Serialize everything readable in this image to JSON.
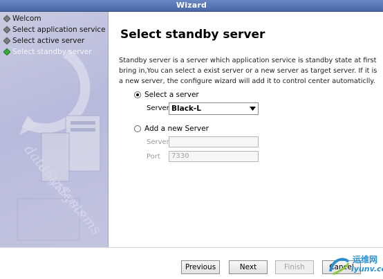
{
  "window": {
    "title": "Wizard"
  },
  "sidebar": {
    "steps": [
      {
        "label": "Welcom",
        "state": "done"
      },
      {
        "label": "Select application service type",
        "state": "done"
      },
      {
        "label": "Select active server",
        "state": "done"
      },
      {
        "label": "Select standby server",
        "state": "current"
      }
    ],
    "art_text": [
      "dataSystems",
      "dataSystems"
    ]
  },
  "main": {
    "heading": "Select standby server",
    "description": "Standby server is a server which application service is standby state at first bring in,You can select a exist server or a new server as target server. If it is a new server, the configure wizard will add it to control center automaticlly.",
    "option_existing": {
      "label": "Select a server",
      "selected": true
    },
    "server_select": {
      "label": "Server:",
      "value": "Black-L"
    },
    "option_new": {
      "label": "Add a new Server",
      "selected": false
    },
    "new_server": {
      "label": "Server",
      "value": ""
    },
    "new_port": {
      "label": "Port",
      "value": "7330"
    }
  },
  "footer": {
    "previous_label": "Previous",
    "next_label": "Next",
    "finish_label": "Finish",
    "cancel_label": "Cancel"
  },
  "watermark": {
    "line1": "运维网",
    "line2": "iyunv.com"
  },
  "colors": {
    "titlebar": "#5474b6",
    "sidebar": "#bfc2dd",
    "completed_step": "#7c7c7c",
    "current_step": "#3aa53a"
  }
}
